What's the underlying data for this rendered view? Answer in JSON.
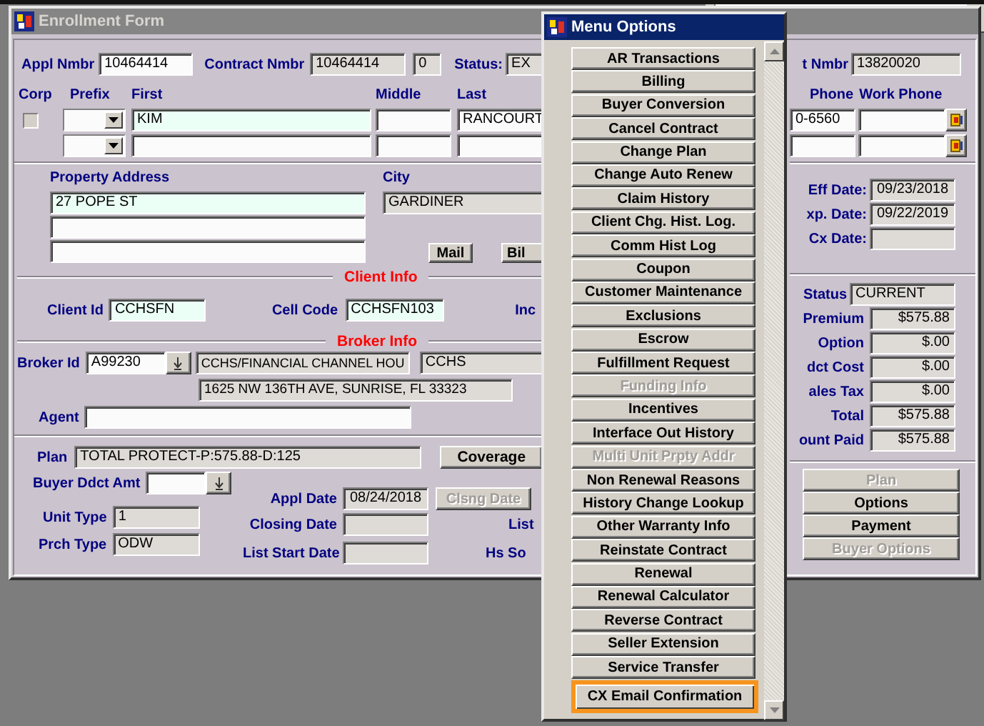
{
  "enrollment_window": {
    "title": "Enrollment Form"
  },
  "header": {
    "appl_nmbr_label": "Appl Nmbr",
    "appl_nmbr": "10464414",
    "contract_nmbr_label": "Contract Nmbr",
    "contract_nmbr": "10464414",
    "contract_seq": "0",
    "status_label": "Status:",
    "status": "EX"
  },
  "name_labels": {
    "corp": "Corp",
    "prefix": "Prefix",
    "first": "First",
    "middle": "Middle",
    "last": "Last"
  },
  "corp_checked": false,
  "name": {
    "first": "KIM",
    "last": "RANCOURT"
  },
  "address": {
    "property_address_label": "Property Address",
    "line_1": "27 POPE ST",
    "city_label": "City",
    "city": "GARDINER",
    "mail_button": "Mail",
    "bill_button": "Bil"
  },
  "client_info": {
    "title": "Client Info",
    "client_id_label": "Client Id",
    "client_id": "CCHSFN",
    "cell_code_label": "Cell Code",
    "cell_code": "CCHSFN103",
    "cut_label": "Inc"
  },
  "broker_info": {
    "title": "Broker Info",
    "broker_id_label": "Broker Id",
    "broker_id": "A99230",
    "broker_name": "CCHS/FINANCIAL CHANNEL HOU",
    "broker_code": "CCHS",
    "broker_address": "1625 NW 136TH AVE, SUNRISE, FL 33323",
    "agent_label": "Agent"
  },
  "plan": {
    "plan_label": "Plan",
    "plan": "TOTAL PROTECT-P:575.88-D:125",
    "coverage_button": "Coverage",
    "buyer_ddct_label": "Buyer Ddct Amt",
    "unit_type_label": "Unit Type",
    "unit_type": "1",
    "prch_type_label": "Prch Type",
    "prch_type": "ODW",
    "appl_date_label": "Appl Date",
    "appl_date": "08/24/2018",
    "clsng_date_button": "Clsng Date",
    "closing_date_label": "Closing Date",
    "list_start_date_label": "List Start Date",
    "cut_label_1": "List",
    "cut_label_2": "Hs So"
  },
  "right_panel": {
    "nmbr_label": "t Nmbr",
    "nmbr": "13820020",
    "phone_label": "Phone",
    "work_phone_label": "Work Phone",
    "phone": "0-6560",
    "eff_date_label": "Eff Date:",
    "eff_date": "09/23/2018",
    "exp_date_label": "xp. Date:",
    "exp_date": "09/22/2019",
    "cx_date_label": "Cx Date:"
  },
  "totals": [
    {
      "label": "Status",
      "value": "CURRENT",
      "kind": "text"
    },
    {
      "label": "Premium",
      "value": "$575.88",
      "kind": "amount"
    },
    {
      "label": "Option",
      "value": "$.00",
      "kind": "amount"
    },
    {
      "label": "dct Cost",
      "value": "$.00",
      "kind": "amount"
    },
    {
      "label": "ales Tax",
      "value": "$.00",
      "kind": "amount"
    },
    {
      "label": "Total",
      "value": "$575.88",
      "kind": "amount"
    },
    {
      "label": "ount Paid",
      "value": "$575.88",
      "kind": "amount"
    }
  ],
  "side_buttons": [
    {
      "label": "Plan",
      "disabled": true
    },
    {
      "label": "Options",
      "disabled": false
    },
    {
      "label": "Payment",
      "disabled": false
    },
    {
      "label": "Buyer Options",
      "disabled": true
    }
  ],
  "menu_window": {
    "title": "Menu Options",
    "items": [
      {
        "label": "AR Transactions",
        "disabled": false,
        "highlighted": false
      },
      {
        "label": "Billing",
        "disabled": false,
        "highlighted": false
      },
      {
        "label": "Buyer Conversion",
        "disabled": false,
        "highlighted": false
      },
      {
        "label": "Cancel Contract",
        "disabled": false,
        "highlighted": false
      },
      {
        "label": "Change Plan",
        "disabled": false,
        "highlighted": false
      },
      {
        "label": "Change Auto Renew",
        "disabled": false,
        "highlighted": false
      },
      {
        "label": "Claim History",
        "disabled": false,
        "highlighted": false
      },
      {
        "label": "Client Chg. Hist. Log.",
        "disabled": false,
        "highlighted": false
      },
      {
        "label": "Comm Hist Log",
        "disabled": false,
        "highlighted": false
      },
      {
        "label": "Coupon",
        "disabled": false,
        "highlighted": false
      },
      {
        "label": "Customer Maintenance",
        "disabled": false,
        "highlighted": false
      },
      {
        "label": "Exclusions",
        "disabled": false,
        "highlighted": false
      },
      {
        "label": "Escrow",
        "disabled": false,
        "highlighted": false
      },
      {
        "label": "Fulfillment Request",
        "disabled": false,
        "highlighted": false
      },
      {
        "label": "Funding Info",
        "disabled": true,
        "highlighted": false
      },
      {
        "label": "Incentives",
        "disabled": false,
        "highlighted": false
      },
      {
        "label": "Interface Out History",
        "disabled": false,
        "highlighted": false
      },
      {
        "label": "Multi Unit Prpty Addr",
        "disabled": true,
        "highlighted": false
      },
      {
        "label": "Non Renewal Reasons",
        "disabled": false,
        "highlighted": false
      },
      {
        "label": "History Change Lookup",
        "disabled": false,
        "highlighted": false
      },
      {
        "label": "Other Warranty Info",
        "disabled": false,
        "highlighted": false
      },
      {
        "label": "Reinstate Contract",
        "disabled": false,
        "highlighted": false
      },
      {
        "label": "Renewal",
        "disabled": false,
        "highlighted": false
      },
      {
        "label": "Renewal Calculator",
        "disabled": false,
        "highlighted": false
      },
      {
        "label": "Reverse Contract",
        "disabled": false,
        "highlighted": false
      },
      {
        "label": "Seller Extension",
        "disabled": false,
        "highlighted": false
      },
      {
        "label": "Service Transfer",
        "disabled": false,
        "highlighted": false
      },
      {
        "label": "CX Email Confirmation",
        "disabled": false,
        "highlighted": true
      }
    ]
  }
}
